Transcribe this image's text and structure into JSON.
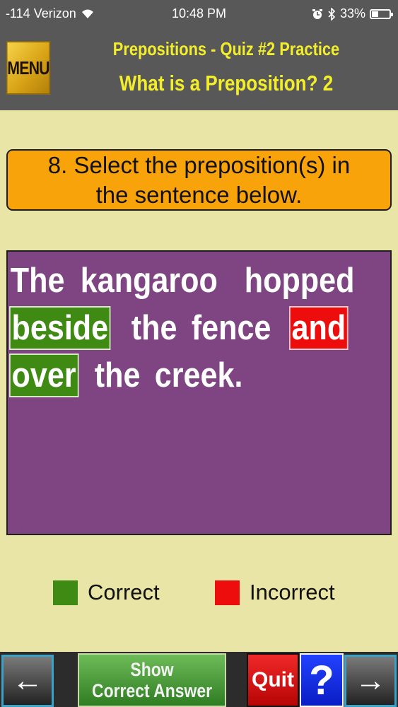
{
  "status_bar": {
    "carrier": "-114 Verizon",
    "time": "10:48 PM",
    "battery": "33%"
  },
  "header": {
    "menu_label": "MENU",
    "line1": "Prepositions - Quiz #2 Practice",
    "line2": "What is a Preposition? 2"
  },
  "question": {
    "line1": "8. Select the preposition(s) in",
    "line2": "the sentence below."
  },
  "sentence": {
    "words": [
      {
        "text": "The",
        "state": "none"
      },
      {
        "text": "kangaroo",
        "state": "none"
      },
      {
        "text": "hopped",
        "state": "none"
      },
      {
        "text": "beside",
        "state": "correct"
      },
      {
        "text": "the",
        "state": "none"
      },
      {
        "text": "fence",
        "state": "none"
      },
      {
        "text": "and",
        "state": "incorrect"
      },
      {
        "text": "over",
        "state": "correct"
      },
      {
        "text": "the",
        "state": "none"
      },
      {
        "text": "creek.",
        "state": "none"
      }
    ]
  },
  "legend": {
    "correct_label": "Correct",
    "incorrect_label": "Incorrect",
    "correct_color": "#3e8a12",
    "incorrect_color": "#ee0d0d"
  },
  "toolbar": {
    "back_icon": "←",
    "show_line1": "Show",
    "show_line2": "Correct Answer",
    "quit_label": "Quit",
    "help_label": "?",
    "next_icon": "→"
  },
  "colors": {
    "background": "#e8e5a6",
    "header_bg": "#585858",
    "header_text": "#f3ee2c",
    "question_bg": "#f9a30b",
    "panel_bg": "#7e4582"
  }
}
